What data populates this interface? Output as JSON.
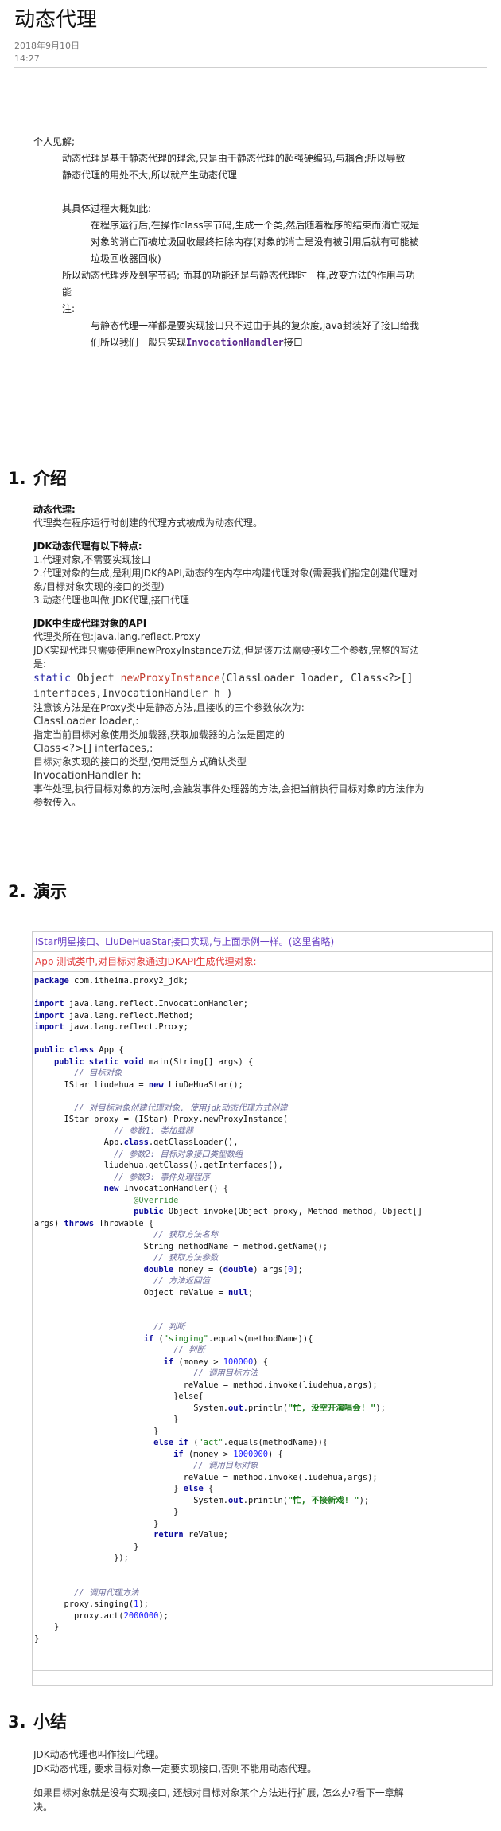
{
  "article": {
    "title": "动态代理",
    "date": "2018年9月10日",
    "time": "14:27"
  },
  "intro": {
    "l1": "个人见解;",
    "l2": "动态代理是基于静态代理的理念,只是由于静态代理的超强硬编码,与耦合;所以导致",
    "l3": "静态代理的用处不大,所以就产生动态代理",
    "l4": "其具体过程大概如此:",
    "l5": "在程序运行后,在操作class字节码,生成一个类,然后随着程序的结束而消亡或是",
    "l6": "对象的消亡而被垃圾回收最终扫除内存(对象的消亡是没有被引用后就有可能被",
    "l7": "垃圾回收器回收)",
    "l8": "所以动态代理涉及到字节码; 而其的功能还是与静态代理时一样,改变方法的作用与功",
    "l9": "能",
    "l10": "注:",
    "l11": "与静态代理一样都是要实现接口只不过由于其的复杂度,java封装好了接口给我",
    "l12a": "们所以我们一般只实现",
    "l12b": "InvocationHandler",
    "l12c": "接口"
  },
  "sections": {
    "s1": {
      "num": "1.",
      "title": "介绍"
    },
    "s2": {
      "num": "2.",
      "title": "演示"
    },
    "s3": {
      "num": "3.",
      "title": "小结"
    }
  },
  "intro_section": {
    "h_dp": "动态代理:",
    "dp_def": "代理类在程序运行时创建的代理方式被成为动态代理。",
    "h_jdk": "JDK动态代理有以下特点:",
    "jdk1": "1.代理对象,不需要实现接口",
    "jdk2": "2.代理对象的生成,是利用JDK的API,动态的在内存中构建代理对象(需要我们指定创建代理对",
    "jdk2b": "象/目标对象实现的接口的类型)",
    "jdk3": "3.动态代理也叫做:JDK代理,接口代理",
    "h_api": "JDK中生成代理对象的API",
    "api1": "代理类所在包:java.lang.reflect.Proxy",
    "api2": "JDK实现代理只需要使用newProxyInstance方法,但是该方法需要接收三个参数,完整的写法",
    "api2b": "是:",
    "sig_static": "static",
    "sig_obj": " Object ",
    "sig_fn": "newProxyInstance",
    "sig_rest1": "(ClassLoader loader, Class<?>[]",
    "sig_rest2": "interfaces,InvocationHandler h )",
    "note": "注意该方法是在Proxy类中是静态方法,且接收的三个参数依次为:",
    "p1": "ClassLoader loader,:",
    "p1d": "指定当前目标对象使用类加载器,获取加载器的方法是固定的",
    "p2": "Class<?>[] interfaces,:",
    "p2d": "目标对象实现的接口的类型,使用泛型方式确认类型",
    "p3": "InvocationHandler h:",
    "p3d": "事件处理,执行目标对象的方法时,会触发事件处理器的方法,会把当前执行目标对象的方法作为",
    "p3d2": "参数传入。"
  },
  "demo": {
    "cap1": "IStar明星接口、LiuDeHuaStar接口实现,与上面示例一样。(这里省略)",
    "cap2": "App 测试类中,对目标对象通过JDKAPI生成代理对象:"
  },
  "code": {
    "pkg_kw": "package",
    "pkg": " com.itheima.proxy2_jdk;",
    "imp_kw": "import",
    "imp1": " java.lang.reflect.InvocationHandler;",
    "imp2": " java.lang.reflect.Method;",
    "imp3": " java.lang.reflect.Proxy;",
    "class_kw": "public class",
    "class_rest": " App {",
    "main_kw": "public static void",
    "main_rest": " main(String[] args) {",
    "c_target": "// 目标对象",
    "star_decl": "IStar liudehua = ",
    "new_kw": "new",
    "star_new": " LiuDeHuaStar();",
    "c_proxy": "// 对目标对象创建代理对象, 使用jdk动态代理方式创建",
    "proxy_decl": "IStar proxy = (IStar) Proxy.newProxyInstance(",
    "c_p1": "// 参数1: 类加载器",
    "p1_a": "App.",
    "class_kw2": "class",
    "p1_b": ".getClassLoader(),",
    "c_p2": "// 参数2: 目标对象接口类型数组",
    "p2_line": "liudehua.getClass().getInterfaces(),",
    "c_p3": "// 参数3: 事件处理程序",
    "p3_rest": " InvocationHandler() {",
    "override": "@Override",
    "pub_kw": "public",
    "invoke_rest": " Object invoke(Object proxy, Method method, Object[]",
    "invoke_args": "args) ",
    "throws_kw": "throws",
    "throwable": " Throwable {",
    "c_mname": "// 获取方法名称",
    "mname": "String methodName = method.getName();",
    "c_params": "// 获取方法参数",
    "double_kw": "double",
    "money_a": " money = (",
    "money_b": ") args[",
    "zero": "0",
    "money_c": "];",
    "c_ret": "// 方法返回值",
    "rev_a": "Object reValue = ",
    "null_kw": "null",
    "semi": ";",
    "c_judge": "// 判断",
    "if_kw": "if",
    "singing_str": "\"singing\"",
    "eq_rest": ".equals(methodName)){",
    "c_judge2": "// 判断",
    "money_cmp": " (money > ",
    "n100k": "100000",
    "close_brace": ") {",
    "c_call": "// 调用目标方法",
    "invoke_call": "reValue = method.invoke(liudehua,args);",
    "else_open": "}else{",
    "sys_a": "System.",
    "out_kw": "out",
    "sys_b": ".println(",
    "busy1": "\"忙, 没空开演唱会! \"",
    "sys_c": ");",
    "rbrace": "}",
    "elseif_kw": "else if",
    "act_str": "\"act\"",
    "n1m": "1000000",
    "c_call2": "// 调用目标对象",
    "else_kw": "else",
    "busy2": "\"忙, 不接新戏! \"",
    "return_kw": "return",
    "ret_rest": " reValue;",
    "close_paren": "});",
    "c_callproxy": "// 调用代理方法",
    "sing_call": "proxy.singing(",
    "n1": "1",
    "close_call": ");",
    "act_call": "proxy.act(",
    "n2m": "2000000"
  },
  "summary": {
    "l1": "JDK动态代理也叫作接口代理。",
    "l2": "JDK动态代理, 要求目标对象一定要实现接口,否则不能用动态代理。",
    "l3": "如果目标对象就是没有实现接口, 还想对目标对象某个方法进行扩展, 怎么办?看下一章解",
    "l4": "决。"
  }
}
